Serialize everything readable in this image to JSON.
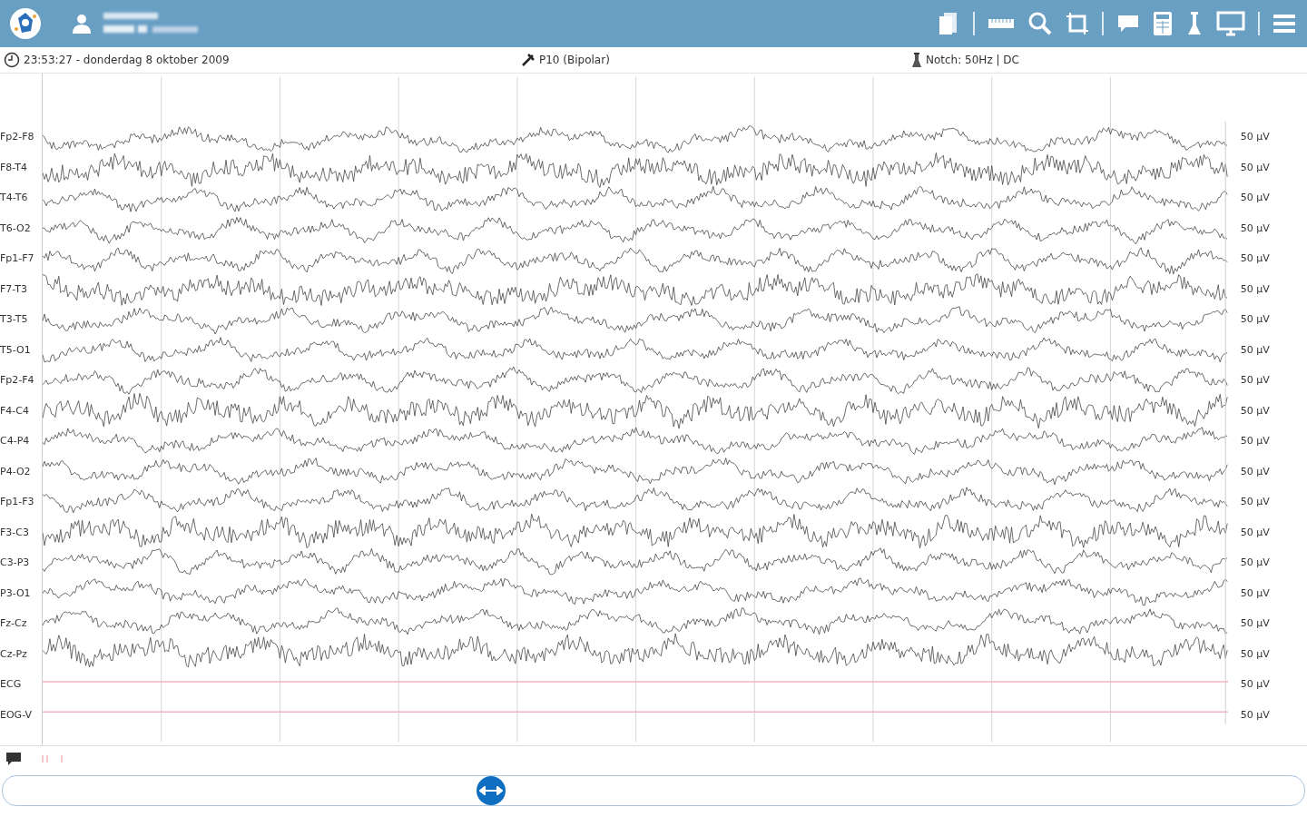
{
  "info_bar": {
    "time": "23:53:27 - donderdag 8 oktober 2009",
    "montage": "P10 (Bipolar)",
    "filter": "Notch: 50Hz | DC"
  },
  "channels": [
    {
      "label": "Fp2-F8",
      "kind": "eeg",
      "scale": "50 µV"
    },
    {
      "label": "F8-T4",
      "kind": "eeg",
      "scale": "50 µV"
    },
    {
      "label": "T4-T6",
      "kind": "eeg",
      "scale": "50 µV"
    },
    {
      "label": "T6-O2",
      "kind": "eeg",
      "scale": "50 µV"
    },
    {
      "label": "Fp1-F7",
      "kind": "eeg",
      "scale": "50 µV"
    },
    {
      "label": "F7-T3",
      "kind": "eeg",
      "scale": "50 µV"
    },
    {
      "label": "T3-T5",
      "kind": "eeg",
      "scale": "50 µV"
    },
    {
      "label": "T5-O1",
      "kind": "eeg",
      "scale": "50 µV"
    },
    {
      "label": "Fp2-F4",
      "kind": "eeg",
      "scale": "50 µV"
    },
    {
      "label": "F4-C4",
      "kind": "eeg",
      "scale": "50 µV"
    },
    {
      "label": "C4-P4",
      "kind": "eeg",
      "scale": "50 µV"
    },
    {
      "label": "P4-O2",
      "kind": "eeg",
      "scale": "50 µV"
    },
    {
      "label": "Fp1-F3",
      "kind": "eeg",
      "scale": "50 µV"
    },
    {
      "label": "F3-C3",
      "kind": "eeg",
      "scale": "50 µV"
    },
    {
      "label": "C3-P3",
      "kind": "eeg",
      "scale": "50 µV"
    },
    {
      "label": "P3-O1",
      "kind": "eeg",
      "scale": "50 µV"
    },
    {
      "label": "Fz-Cz",
      "kind": "eeg",
      "scale": "50 µV"
    },
    {
      "label": "Cz-Pz",
      "kind": "eeg",
      "scale": "50 µV"
    },
    {
      "label": "ECG",
      "kind": "flat",
      "scale": "50 µV"
    },
    {
      "label": "EOG-V",
      "kind": "flat",
      "scale": "50 µV"
    }
  ],
  "timeline": {
    "level": 0.375
  }
}
